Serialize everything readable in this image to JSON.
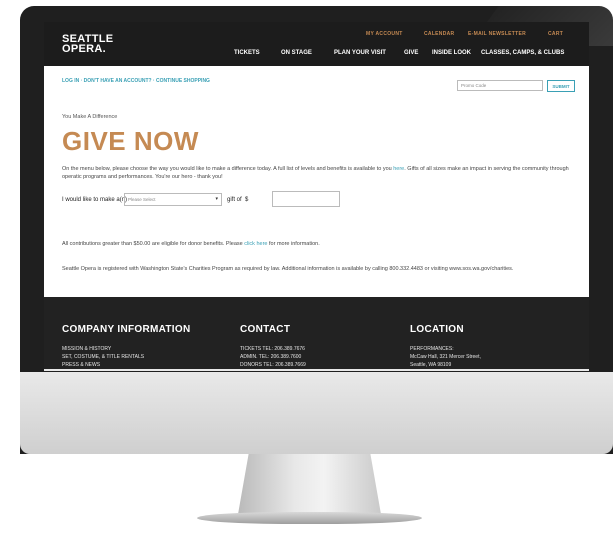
{
  "header": {
    "logo_line1": "SEATTLE",
    "logo_line2": "OPERA.",
    "utility_links": [
      "MY ACCOUNT",
      "CALENDAR",
      "E-MAIL NEWSLETTER",
      "CART"
    ],
    "nav_items": [
      "TICKETS",
      "ON STAGE",
      "PLAN YOUR VISIT",
      "GIVE",
      "INSIDE LOOK",
      "CLASSES, CAMPS, & CLUBS"
    ]
  },
  "account_bar": {
    "text": "LOG IN · DON'T HAVE AN ACCOUNT? · CONTINUE SHOPPING",
    "promo_placeholder": "Promo Code",
    "submit_label": "SUBMIT"
  },
  "main": {
    "subtitle": "You Make A Difference",
    "title": "GIVE NOW",
    "intro_before_link": "On the menu below, please choose the way you would like to make a difference today. A full list of levels and benefits is available to you ",
    "intro_link": "here",
    "intro_after_link": ". Gifts of all sizes make an impact in serving the community through operatic programs and performances. You're our hero - thank you!",
    "gift_label": "I would like to make a(n)",
    "select_value": "Please Select",
    "gift_of_label": "gift of",
    "currency_symbol": "$",
    "contrib_before_link": "All contributions greater than $50.00 are eligible for donor benefits. Please ",
    "contrib_link": "click here",
    "contrib_after_link": " for more information.",
    "registration_note": "Seattle Opera is registered with Washington State's Charities Program as required by law. Additional information is available by calling 800.332.4483 or visiting www.sos.wa.gov/charities."
  },
  "footer": {
    "company": {
      "heading": "COMPANY INFORMATION",
      "lines": [
        "MISSION & HISTORY",
        "SET, COSTUME, & TITLE RENTALS",
        "PRESS & NEWS"
      ]
    },
    "contact": {
      "heading": "CONTACT",
      "lines": [
        "TICKETS TEL: 206.389.7676",
        "ADMIN. TEL: 206.389.7600",
        "DONORS TEL: 206.389.7669"
      ]
    },
    "location": {
      "heading": "LOCATION",
      "lines": [
        "PERFORMANCES:",
        "McCaw Hall, 321 Mercer Street,",
        "Seattle, WA 98109"
      ]
    }
  }
}
